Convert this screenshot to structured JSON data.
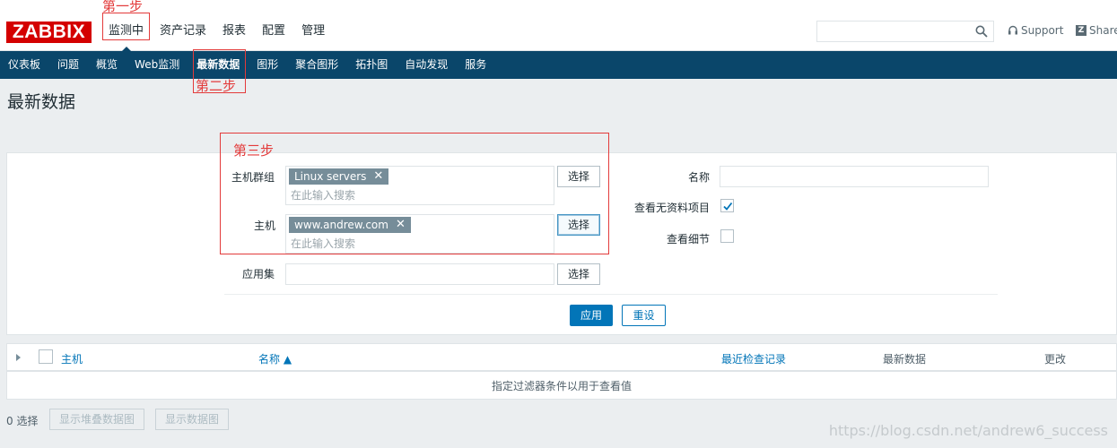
{
  "header": {
    "logo": "ZABBIX",
    "menu": [
      {
        "label": "监测中",
        "active": true
      },
      {
        "label": "资产记录",
        "active": false
      },
      {
        "label": "报表",
        "active": false
      },
      {
        "label": "配置",
        "active": false
      },
      {
        "label": "管理",
        "active": false
      }
    ],
    "search": {
      "value": "",
      "placeholder": ""
    },
    "support_label": "Support",
    "share_label": "Share"
  },
  "subnav": [
    {
      "label": "仪表板"
    },
    {
      "label": "问题"
    },
    {
      "label": "概览"
    },
    {
      "label": "Web监测"
    },
    {
      "label": "最新数据"
    },
    {
      "label": "图形"
    },
    {
      "label": "聚合图形"
    },
    {
      "label": "拓扑图"
    },
    {
      "label": "自动发现"
    },
    {
      "label": "服务"
    }
  ],
  "page_title": "最新数据",
  "filter": {
    "host_group_label": "主机群组",
    "host_group_tag": "Linux servers",
    "host_group_placeholder": "在此输入搜索",
    "host_label": "主机",
    "host_tag": "www.andrew.com",
    "host_placeholder": "在此输入搜索",
    "application_label": "应用集",
    "application_value": "",
    "select_label": "选择",
    "name_label": "名称",
    "name_value": "",
    "show_without_data_label": "查看无资料项目",
    "show_without_data_checked": true,
    "show_details_label": "查看细节",
    "show_details_checked": false,
    "apply_label": "应用",
    "reset_label": "重设"
  },
  "table": {
    "col_host": "主机",
    "col_name": "名称 ▲",
    "col_last_check": "最近检查记录",
    "col_last_value": "最新数据",
    "col_change": "更改",
    "empty_message": "指定过滤器条件以用于查看值"
  },
  "footer": {
    "selected_count": "0 选择",
    "btn_stacked_graph": "显示堆叠数据图",
    "btn_graph": "显示数据图"
  },
  "annotations": {
    "step1": "第一步",
    "step2": "第二步",
    "step3": "第三步"
  },
  "watermark": "https://blog.csdn.net/andrew6_success",
  "colors": {
    "brand_red": "#d40000",
    "nav_blue": "#0a466a",
    "link_blue": "#0275b8",
    "annotation_red": "#e33b3b",
    "tag_gray": "#768d99"
  }
}
